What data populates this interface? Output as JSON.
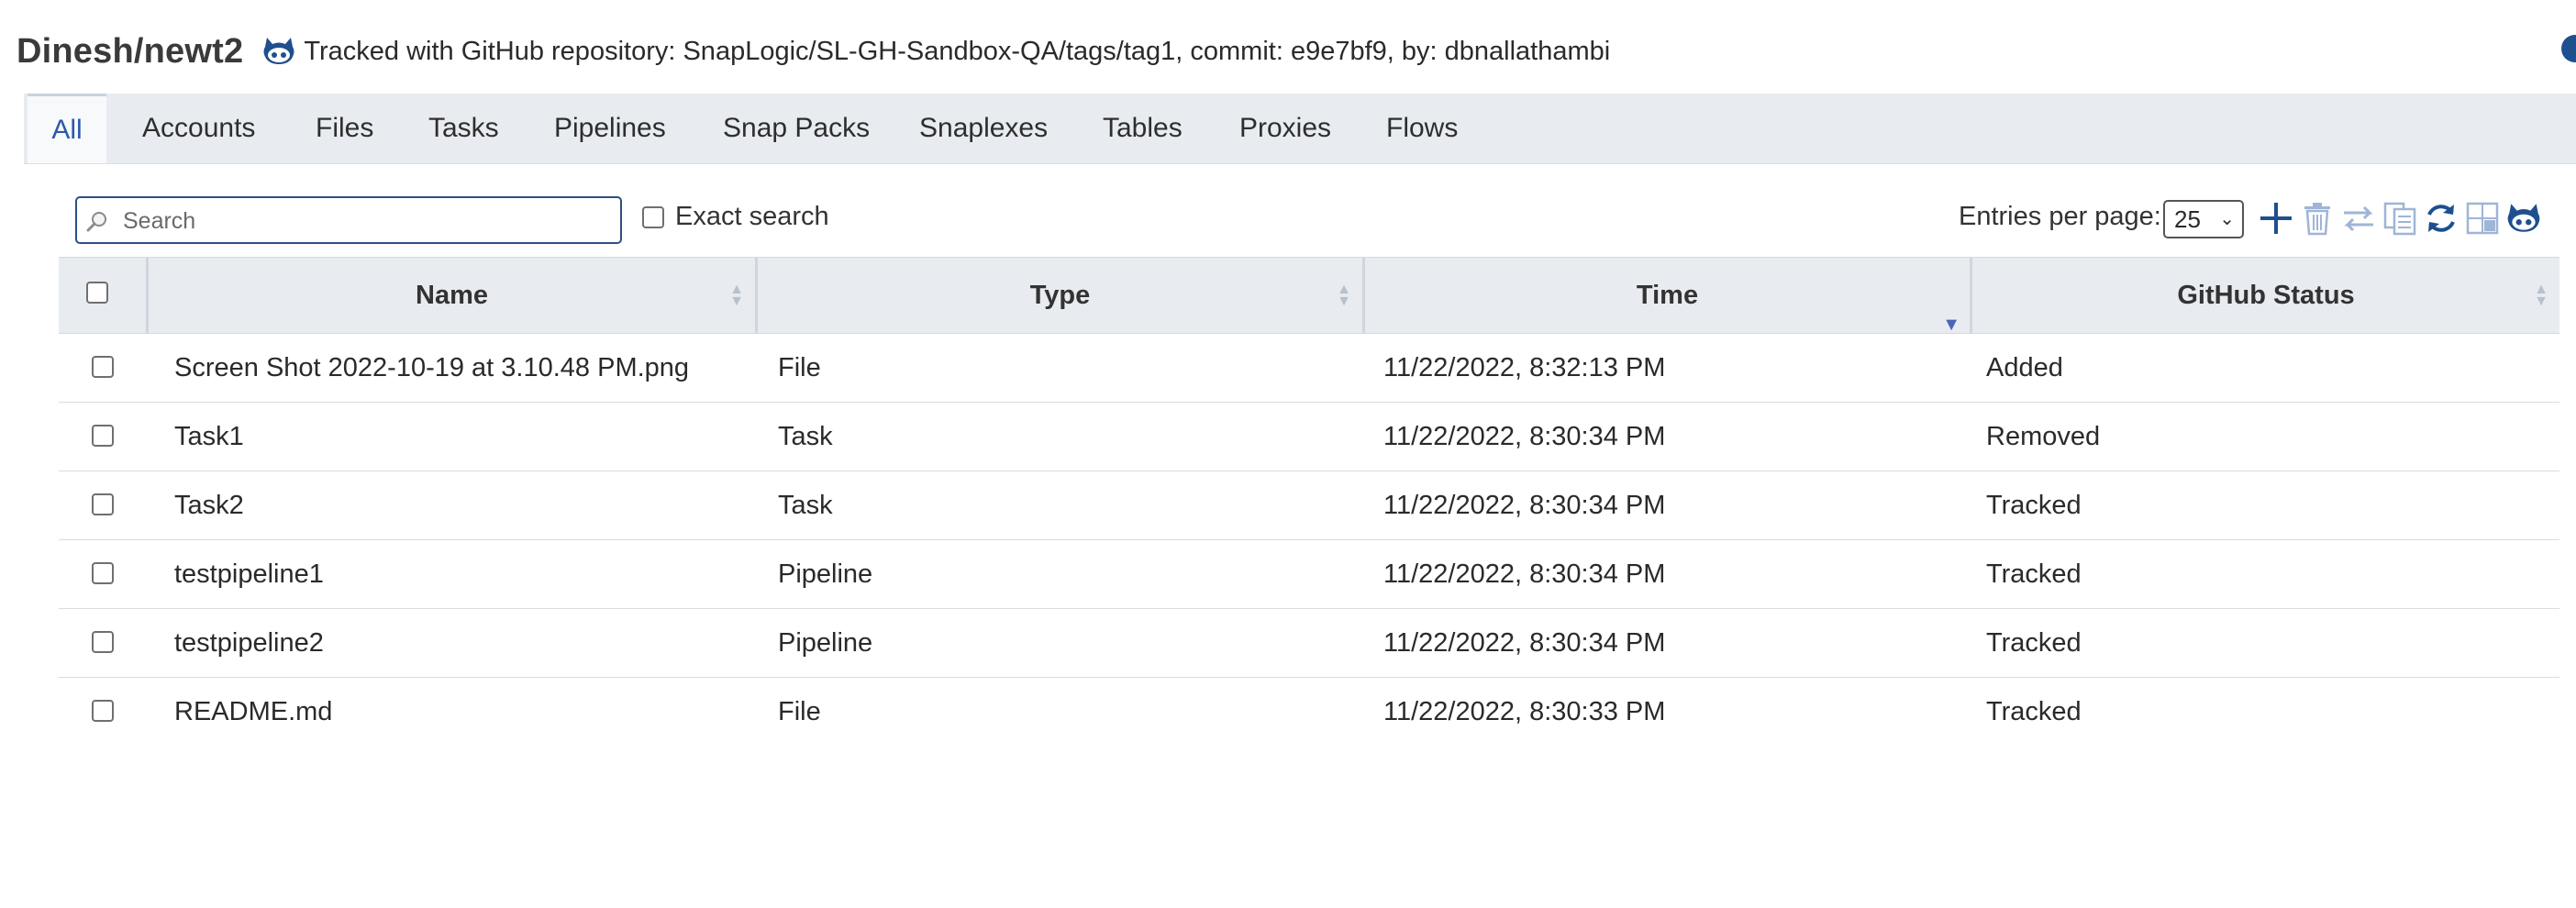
{
  "header": {
    "project_path": "Dinesh/newt2",
    "tracked_text": "Tracked with GitHub repository: SnapLogic/SL-GH-Sandbox-QA/tags/tag1, commit: e9e7bf9, by: dbnallathambi"
  },
  "tabs": [
    {
      "label": "All",
      "active": true
    },
    {
      "label": "Accounts"
    },
    {
      "label": "Files"
    },
    {
      "label": "Tasks"
    },
    {
      "label": "Pipelines"
    },
    {
      "label": "Snap Packs"
    },
    {
      "label": "Snaplexes"
    },
    {
      "label": "Tables"
    },
    {
      "label": "Proxies"
    },
    {
      "label": "Flows"
    }
  ],
  "toolbar": {
    "search_placeholder": "Search",
    "exact_search_label": "Exact search",
    "entries_label": "Entries per page:",
    "entries_value": "25",
    "icons": [
      "add-icon",
      "delete-icon",
      "move-icon",
      "copy-icon",
      "refresh-icon",
      "import-icon",
      "github-icon"
    ]
  },
  "table": {
    "columns": [
      "Name",
      "Type",
      "Time",
      "GitHub Status"
    ],
    "sorted_column": "Time",
    "rows": [
      {
        "name": "Screen Shot 2022-10-19 at 3.10.48 PM.png",
        "type": "File",
        "time": "11/22/2022, 8:32:13 PM",
        "status": "Added"
      },
      {
        "name": "Task1",
        "type": "Task",
        "time": "11/22/2022, 8:30:34 PM",
        "status": "Removed"
      },
      {
        "name": "Task2",
        "type": "Task",
        "time": "11/22/2022, 8:30:34 PM",
        "status": "Tracked"
      },
      {
        "name": "testpipeline1",
        "type": "Pipeline",
        "time": "11/22/2022, 8:30:34 PM",
        "status": "Tracked"
      },
      {
        "name": "testpipeline2",
        "type": "Pipeline",
        "time": "11/22/2022, 8:30:34 PM",
        "status": "Tracked"
      },
      {
        "name": "README.md",
        "type": "File",
        "time": "11/22/2022, 8:30:33 PM",
        "status": "Tracked"
      }
    ]
  },
  "colors": {
    "accent": "#1e4f8f",
    "tab_active_text": "#2b5aa8",
    "header_bg": "#e8ecf1"
  }
}
